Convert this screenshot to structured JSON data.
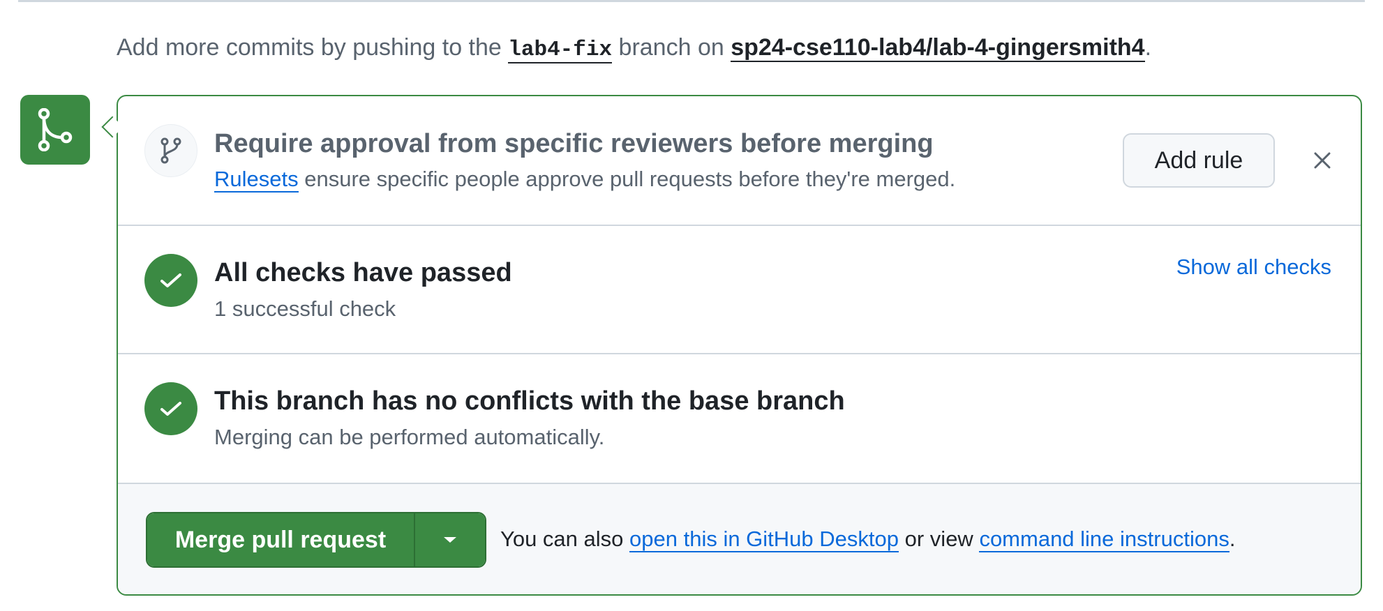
{
  "hint": {
    "prefix": "Add more commits by pushing to the ",
    "branch": "lab4-fix",
    "middle": " branch on ",
    "repo": "sp24-cse110-lab4/lab-4-gingersmith4",
    "suffix": "."
  },
  "ruleset": {
    "title": "Require approval from specific reviewers before merging",
    "link_text": "Rulesets",
    "description": " ensure specific people approve pull requests before they're merged.",
    "add_rule_label": "Add rule"
  },
  "checks": {
    "title": "All checks have passed",
    "subtitle": "1 successful check",
    "show_all_label": "Show all checks"
  },
  "conflicts": {
    "title": "This branch has no conflicts with the base branch",
    "subtitle": "Merging can be performed automatically."
  },
  "merge": {
    "button_label": "Merge pull request",
    "note_prefix": "You can also ",
    "desktop_link": "open this in GitHub Desktop",
    "note_middle": " or view ",
    "cli_link": "command line instructions",
    "note_suffix": "."
  },
  "icons": {
    "badge": "git-merge-icon",
    "ruleset": "git-branch-icon",
    "checks": "check-icon",
    "conflicts": "check-icon",
    "close": "close-icon",
    "dropdown": "triangle-down-icon"
  },
  "colors": {
    "success_green": "#3b8a43",
    "link_blue": "#0969da",
    "muted_text": "#59636e",
    "border": "#d0d7de"
  }
}
